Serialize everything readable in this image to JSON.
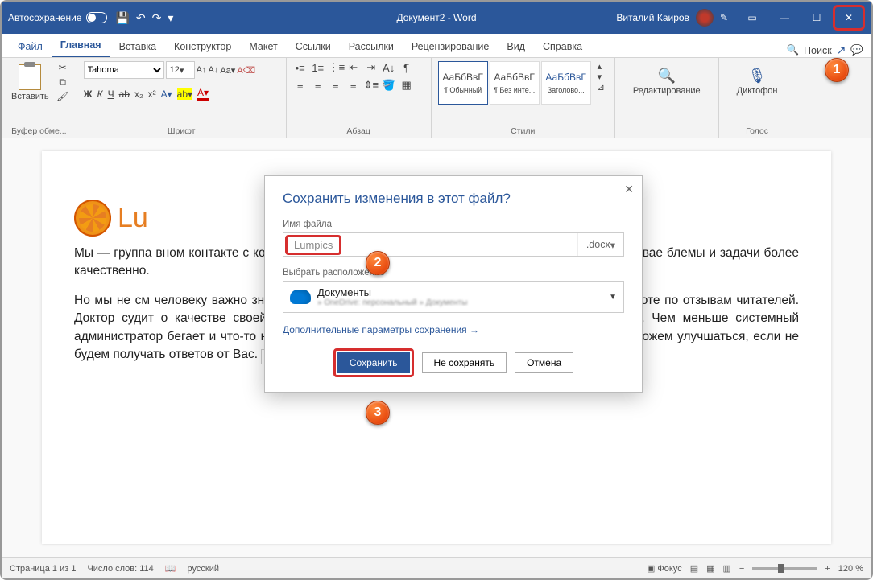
{
  "titlebar": {
    "autosave": "Автосохранение",
    "doc_title": "Документ2 - Word",
    "user": "Виталий Каиров"
  },
  "tabs": {
    "file": "Файл",
    "home": "Главная",
    "insert": "Вставка",
    "design": "Конструктор",
    "layout": "Макет",
    "references": "Ссылки",
    "mailings": "Рассылки",
    "review": "Рецензирование",
    "view": "Вид",
    "help": "Справка",
    "search": "Поиск"
  },
  "ribbon": {
    "clipboard": {
      "label": "Буфер обме...",
      "paste": "Вставить"
    },
    "font": {
      "label": "Шрифт",
      "name": "Tahoma",
      "size": "12",
      "bold": "Ж",
      "italic": "К",
      "underline": "Ч",
      "strike": "ab",
      "sub": "x₂",
      "sup": "x²"
    },
    "para": {
      "label": "Абзац"
    },
    "styles": {
      "label": "Стили",
      "preview": "АаБбВвГ",
      "s1": "¶ Обычный",
      "s2": "¶ Без инте...",
      "s3": "Заголово..."
    },
    "editing": "Редактирование",
    "voice": "Диктофон",
    "voice_group": "Голос"
  },
  "document": {
    "logo": "Lu",
    "p1": "Мы — группа                                                                                                               вном контакте с компьютерам                                                                                                         нете уже полно информации                                                                                                              и. Но это не останавливае                                                                                                          блемы и задачи более качественно.",
    "p2": "Но мы не см                                                                                                               человеку важно знать, что его действия правильные. Писатель судит о своей работе по отзывам читателей. Доктор судит о качестве своей работы по тому, как быстро выздоравливают его пациенты. Чем меньше системный администратор бегает и что-то настраивает, тем он качественнее делает работу. Так и мы не можем улучшаться, если не будем получать ответов от Вас.",
    "paste_opts": "(Ctrl) ▾"
  },
  "dialog": {
    "title": "Сохранить изменения в этот файл?",
    "filename_label": "Имя файла",
    "filename": "Lumpics",
    "ext": ".docx",
    "location_label": "Выбрать расположение",
    "location_main": "Документы",
    "location_sub": "» OneDrive: персональный » Документы",
    "more": "Дополнительные параметры сохранения →",
    "save": "Сохранить",
    "dont_save": "Не сохранять",
    "cancel": "Отмена"
  },
  "statusbar": {
    "page": "Страница 1 из 1",
    "words": "Число слов: 114",
    "lang": "русский",
    "focus": "Фокус",
    "zoom": "120 %"
  },
  "badges": {
    "b1": "1",
    "b2": "2",
    "b3": "3"
  }
}
